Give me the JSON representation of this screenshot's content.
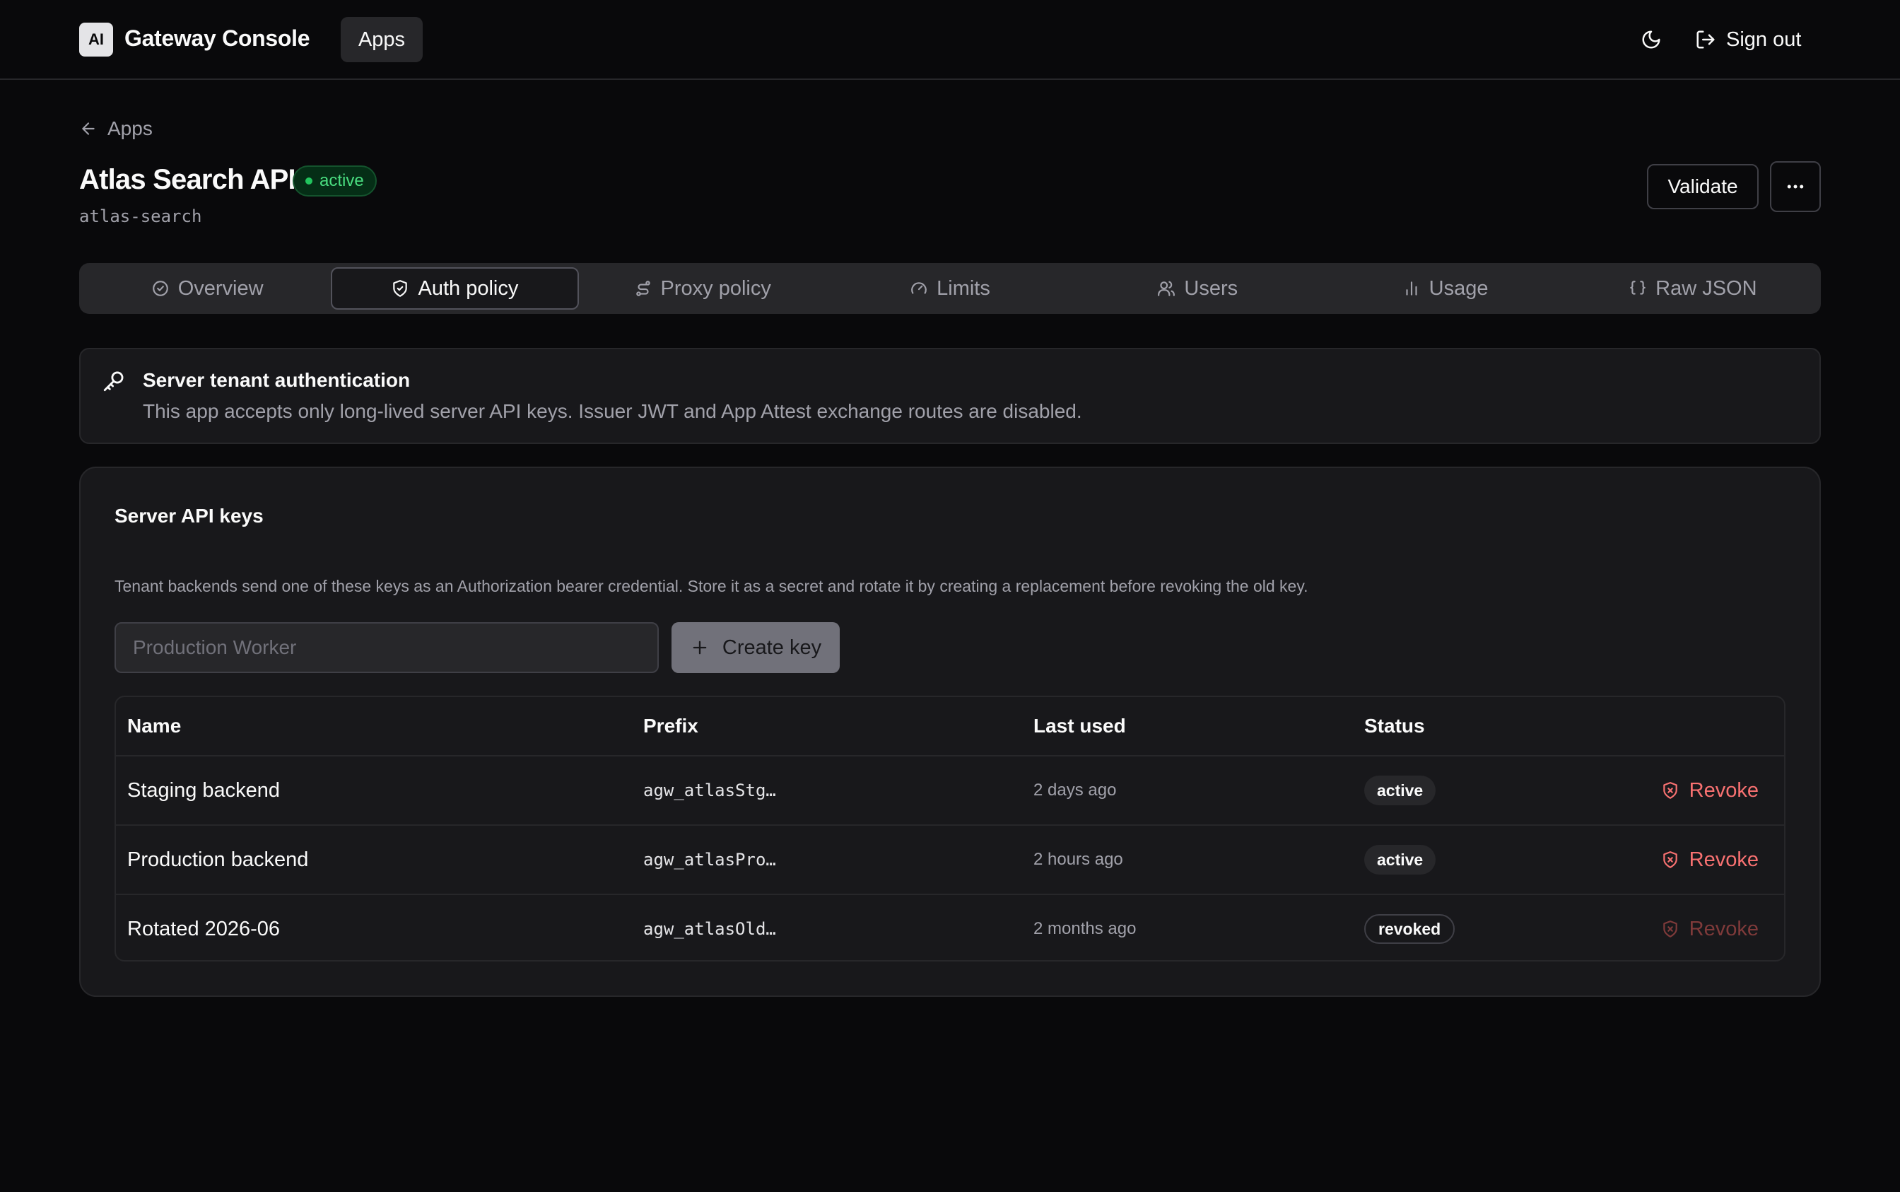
{
  "header": {
    "logo": "AI",
    "brand": "Gateway Console",
    "nav_apps": "Apps",
    "sign_out": "Sign out"
  },
  "page": {
    "back_label": "Apps",
    "app_title": "Atlas Search API",
    "app_status": "active",
    "app_slug": "atlas-search",
    "validate_label": "Validate"
  },
  "tabs": [
    {
      "label": "Overview",
      "icon": "check-circle-icon"
    },
    {
      "label": "Auth policy",
      "icon": "shield-icon"
    },
    {
      "label": "Proxy policy",
      "icon": "route-icon"
    },
    {
      "label": "Limits",
      "icon": "gauge-icon"
    },
    {
      "label": "Users",
      "icon": "users-icon"
    },
    {
      "label": "Usage",
      "icon": "bar-chart-icon"
    },
    {
      "label": "Raw JSON",
      "icon": "braces-icon"
    }
  ],
  "active_tab": "Auth policy",
  "auth_info": {
    "title": "Server tenant authentication",
    "description": "This app accepts only long-lived server API keys. Issuer JWT and App Attest exchange routes are disabled."
  },
  "keys": {
    "title": "Server API keys",
    "description": "Tenant backends send one of these keys as an Authorization bearer credential. Store it as a secret and rotate it by creating a replacement before revoking the old key.",
    "input_placeholder": "Production Worker",
    "input_value": "",
    "create_label": "Create key",
    "columns": {
      "name": "Name",
      "prefix": "Prefix",
      "last_used": "Last used",
      "status": "Status"
    },
    "revoke_label": "Revoke",
    "rows": [
      {
        "name": "Staging backend",
        "prefix": "agw_atlasStg…",
        "last_used": "2 days ago",
        "status": "active"
      },
      {
        "name": "Production backend",
        "prefix": "agw_atlasPro…",
        "last_used": "2 hours ago",
        "status": "active"
      },
      {
        "name": "Rotated 2026-06",
        "prefix": "agw_atlasOld…",
        "last_used": "2 months ago",
        "status": "revoked"
      }
    ]
  },
  "colors": {
    "background": "#09090b",
    "surface": "#18181b",
    "accent_success": "#22c55e",
    "danger": "#f87171"
  }
}
